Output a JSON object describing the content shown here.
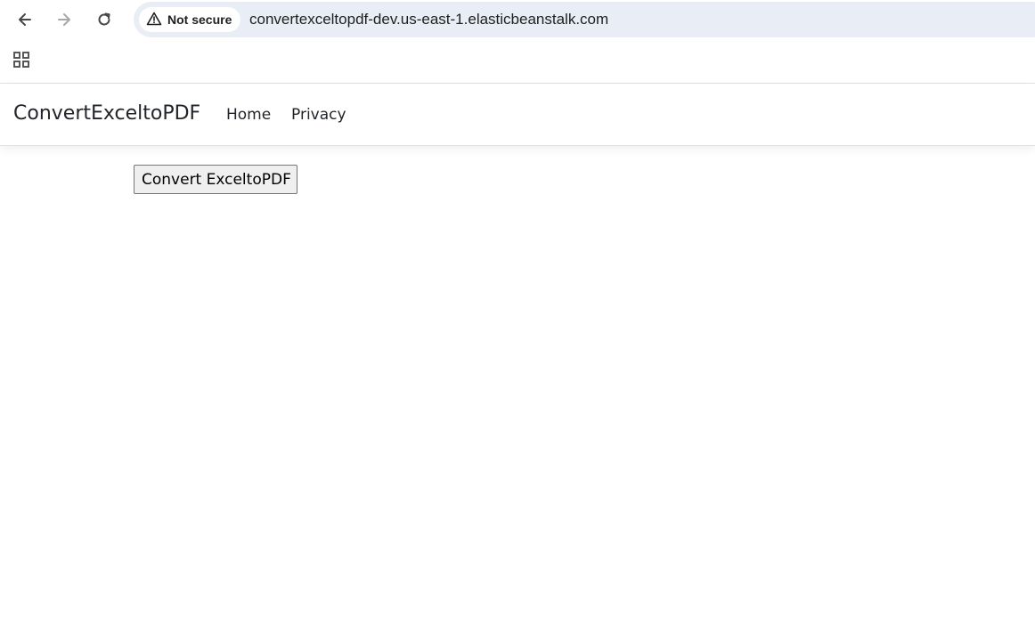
{
  "browser": {
    "security_label": "Not secure",
    "url": "convertexceltopdf-dev.us-east-1.elasticbeanstalk.com",
    "icons": {
      "back": "arrow-left-icon",
      "forward": "arrow-right-icon",
      "reload": "reload-icon",
      "warning": "warning-triangle-icon",
      "apps": "apps-grid-icon"
    }
  },
  "site": {
    "brand": "ConvertExceltoPDF",
    "nav": [
      {
        "label": "Home"
      },
      {
        "label": "Privacy"
      }
    ]
  },
  "main": {
    "convert_button": "Convert ExceltoPDF"
  },
  "colors": {
    "omnibox_bg": "#e9eef6",
    "text": "#212529",
    "button_bg": "#efefef",
    "button_border": "#767676"
  }
}
